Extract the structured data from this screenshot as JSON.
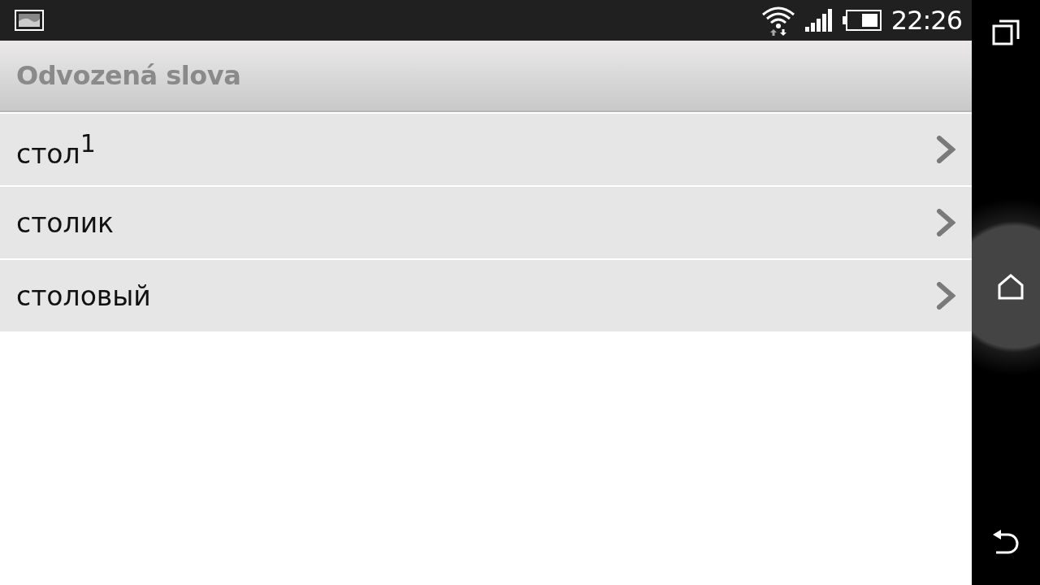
{
  "status_bar": {
    "time": "22:26"
  },
  "action_bar": {
    "title": "Odvozená slova"
  },
  "items": [
    {
      "label": "стол$^{1}$"
    },
    {
      "label": "столик"
    },
    {
      "label": "столовый"
    }
  ]
}
